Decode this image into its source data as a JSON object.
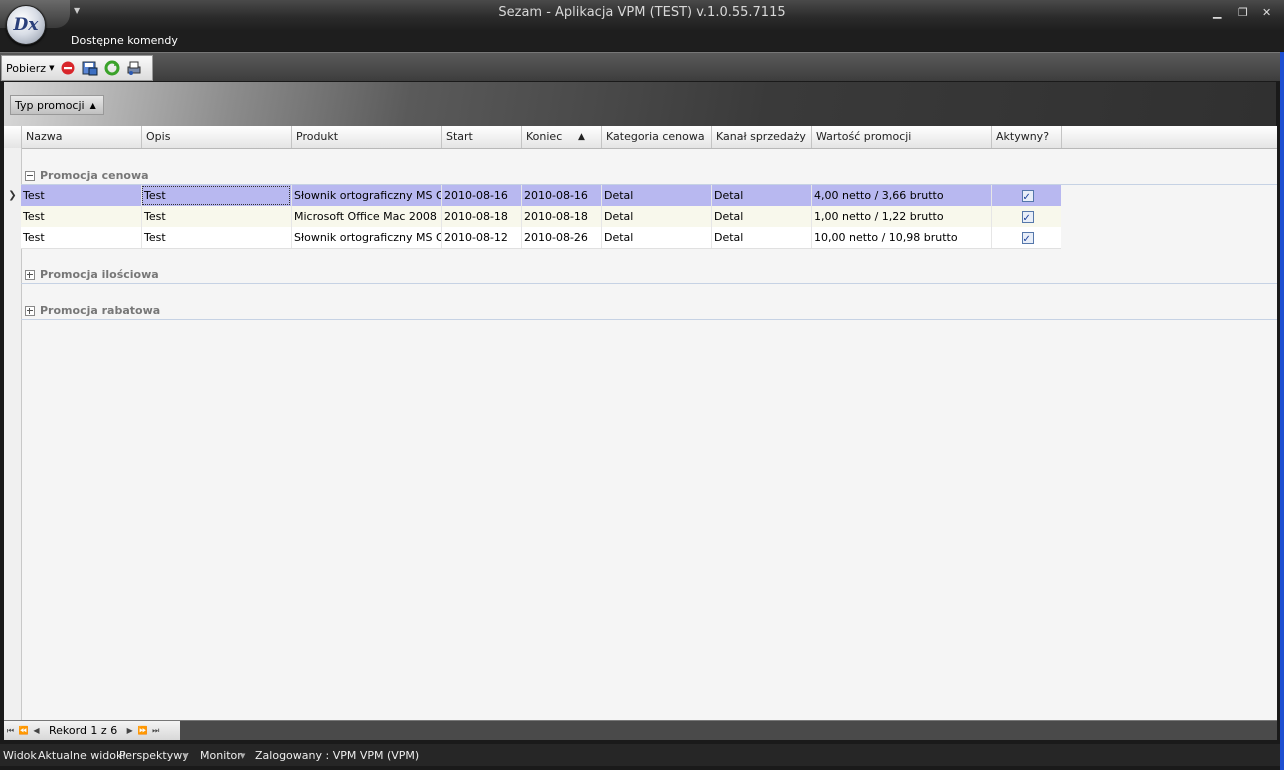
{
  "window": {
    "title": "Sezam - Aplikacja VPM (TEST) v.1.0.55.7115",
    "app_logo": "Dx"
  },
  "menu": {
    "commands_label": "Dostępne komendy"
  },
  "toolbar": {
    "fetch_label": "Pobierz"
  },
  "grouping": {
    "chip_label": "Typ promocji"
  },
  "grid": {
    "columns": [
      "Nazwa",
      "Opis",
      "Produkt",
      "Start",
      "Koniec",
      "Kategoria cenowa",
      "Kanał sprzedaży",
      "Wartość promocji",
      "Aktywny?"
    ],
    "groups": [
      {
        "label": "Promocja cenowa",
        "expanded": true
      },
      {
        "label": "Promocja ilościowa",
        "expanded": false
      },
      {
        "label": "Promocja rabatowa",
        "expanded": false
      }
    ],
    "rows": [
      [
        "Test",
        "Test",
        "Słownik ortograficzny MS O...",
        "2010-08-16",
        "2010-08-16",
        "Detal",
        "Detal",
        "4,00 netto / 3,66 brutto"
      ],
      [
        "Test",
        "Test",
        "Microsoft Office Mac 2008 ...",
        "2010-08-18",
        "2010-08-18",
        "Detal",
        "Detal",
        "1,00 netto / 1,22 brutto"
      ],
      [
        "Test",
        "Test",
        "Słownik ortograficzny MS O...",
        "2010-08-12",
        "2010-08-26",
        "Detal",
        "Detal",
        "10,00 netto / 10,98 brutto"
      ]
    ],
    "active": [
      true,
      true,
      true
    ],
    "selected_row": 0
  },
  "pager": {
    "record_text": "Rekord 1 z 6"
  },
  "status": {
    "view": "Widok",
    "current_views": "Aktualne widoki",
    "perspectives": "Perspektywy",
    "monitor": "Monitor",
    "logged": "Zalogowany : VPM VPM (VPM)"
  },
  "colors": {
    "selected_row": "#b8b8f0",
    "alt_row": "#f8f8ec"
  }
}
